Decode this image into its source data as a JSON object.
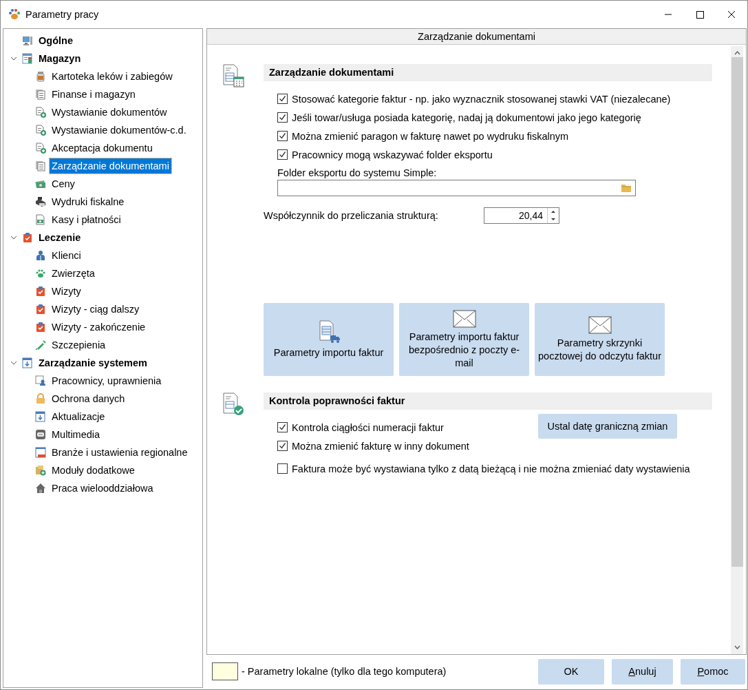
{
  "window": {
    "title": "Parametry pracy"
  },
  "tree": [
    {
      "label": "Ogólne",
      "selected": false
    },
    {
      "label": "Magazyn",
      "selected": false,
      "expanded": true,
      "children": [
        {
          "label": "Kartoteka leków i zabiegów",
          "selected": false
        },
        {
          "label": "Finanse i magazyn",
          "selected": false
        },
        {
          "label": "Wystawianie dokumentów",
          "selected": false
        },
        {
          "label": "Wystawianie dokumentów-c.d.",
          "selected": false
        },
        {
          "label": "Akceptacja dokumentu",
          "selected": false
        },
        {
          "label": "Zarządzanie dokumentami",
          "selected": true
        },
        {
          "label": "Ceny",
          "selected": false
        },
        {
          "label": "Wydruki fiskalne",
          "selected": false
        },
        {
          "label": "Kasy i płatności",
          "selected": false
        }
      ]
    },
    {
      "label": "Leczenie",
      "selected": false,
      "expanded": true,
      "children": [
        {
          "label": "Klienci",
          "selected": false
        },
        {
          "label": "Zwierzęta",
          "selected": false
        },
        {
          "label": "Wizyty",
          "selected": false
        },
        {
          "label": "Wizyty - ciąg dalszy",
          "selected": false
        },
        {
          "label": "Wizyty - zakończenie",
          "selected": false
        },
        {
          "label": "Szczepienia",
          "selected": false
        }
      ]
    },
    {
      "label": "Zarządzanie systemem",
      "selected": false,
      "expanded": true,
      "children": [
        {
          "label": "Pracownicy, uprawnienia",
          "selected": false
        },
        {
          "label": "Ochrona danych",
          "selected": false
        },
        {
          "label": "Aktualizacje",
          "selected": false
        },
        {
          "label": "Multimedia",
          "selected": false
        },
        {
          "label": "Branże i ustawienia regionalne",
          "selected": false
        },
        {
          "label": "Moduły dodatkowe",
          "selected": false
        },
        {
          "label": "Praca wielooddziałowa",
          "selected": false
        }
      ]
    }
  ],
  "panel": {
    "title": "Zarządzanie dokumentami",
    "document_section": {
      "title": "Zarządzanie dokumentami",
      "checks": [
        {
          "label": "Stosować kategorie faktur - np. jako wyznacznik stosowanej stawki VAT (niezalecane)",
          "checked": true
        },
        {
          "label": "Jeśli towar/usługa posiada kategorię, nadaj ją dokumentowi jako jego kategorię",
          "checked": true
        },
        {
          "label": "Można zmienić paragon w fakturę nawet po wydruku fiskalnym",
          "checked": true
        },
        {
          "label": "Pracownicy mogą wskazywać folder eksportu",
          "checked": true
        }
      ],
      "export_field": {
        "label": "Folder eksportu do systemu Simple:"
      },
      "factor": {
        "label": "Współczynnik do przeliczania strukturą:",
        "value": "20,44"
      },
      "tiles": [
        "Parametry importu faktur",
        "Parametry importu faktur bezpośrednio z poczty e-mail",
        "Parametry skrzynki pocztowej do odczytu faktur"
      ]
    },
    "invoice_section": {
      "title": "Kontrola poprawności faktur",
      "checks": [
        {
          "label": "Kontrola ciągłości numeracji faktur",
          "checked": true
        },
        {
          "label": "Można zmienić fakturę w inny dokument",
          "checked": true
        },
        {
          "label": "Faktura może być wystawiana tylko z datą bieżącą i nie można zmieniać daty wystawienia",
          "checked": false
        }
      ],
      "action_button": "Ustal datę graniczną zmian"
    }
  },
  "footer": {
    "legend": "- Parametry lokalne (tylko dla tego komputera)",
    "buttons": [
      {
        "label": "OK",
        "mnemonic": false
      },
      {
        "label": "Anuluj",
        "mnemonic": true
      },
      {
        "label": "Pomoc",
        "mnemonic": true
      }
    ]
  }
}
